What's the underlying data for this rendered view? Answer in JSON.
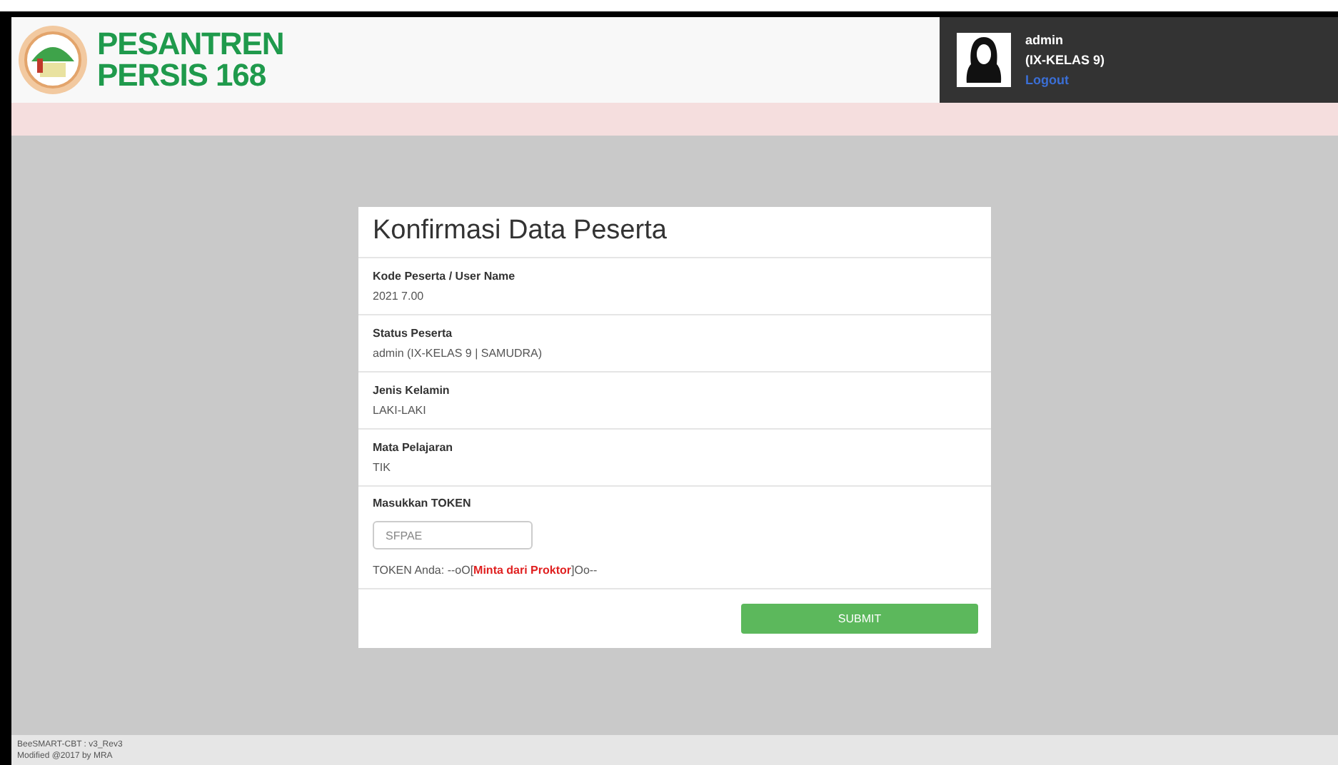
{
  "header": {
    "brand_line_1": "PESANTREN",
    "brand_line_2": "PERSIS 168",
    "user": {
      "name": "admin",
      "class": "(IX-KELAS 9)",
      "logout": "Logout"
    }
  },
  "card": {
    "title": "Konfirmasi Data Peserta",
    "fields": [
      {
        "label": "Kode Peserta / User Name",
        "value": "2021 7.00"
      },
      {
        "label": "Status Peserta",
        "value": "admin (IX-KELAS 9 | SAMUDRA)"
      },
      {
        "label": "Jenis Kelamin",
        "value": "LAKI-LAKI"
      },
      {
        "label": "Mata Pelajaran",
        "value": "TIK"
      }
    ],
    "token": {
      "label": "Masukkan TOKEN",
      "placeholder": "SFPAE",
      "note": "TOKEN Anda: --oO[**Minta dari Proktor**]Oo--"
    },
    "submit": "SUBMIT"
  },
  "footer": {
    "line_1": "BeeSMART-CBT : v3_Rev3",
    "line_2": "Modified @2017 by MRA"
  }
}
